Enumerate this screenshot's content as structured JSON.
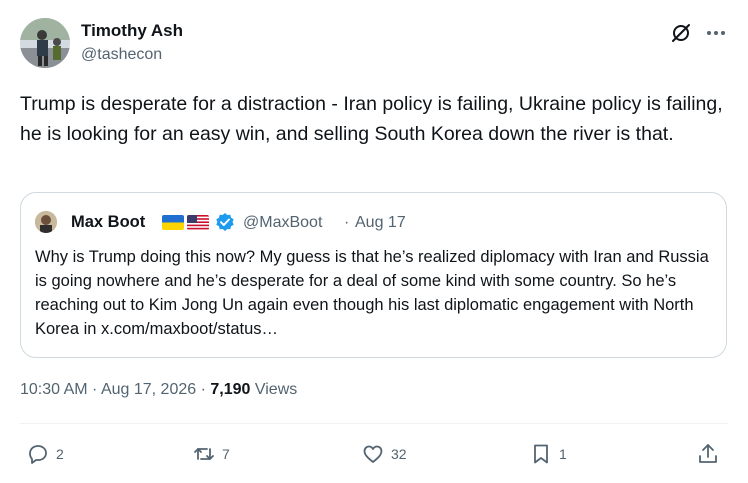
{
  "author": {
    "name": "Timothy Ash",
    "handle": "@tashecon"
  },
  "tweet": {
    "text": "Trump is desperate for a distraction - Iran policy is failing, Ukraine policy is failing, he is looking for an easy win, and selling South Korea down the river is that."
  },
  "quote": {
    "name": "Max Boot",
    "handle": "@MaxBoot",
    "separator": "·",
    "date": "Aug 17",
    "text": "Why is Trump doing this now? My guess is that he’s realized diplomacy with Iran and Russia is going nowhere and he’s desperate for a deal of some kind with some country. So he’s reaching out to Kim Jong Un again even though his last diplomatic engagement with North Korea in x.com/maxboot/status…"
  },
  "meta": {
    "time": "10:30 AM",
    "sep1": " · ",
    "date": "Aug 17, 2026",
    "sep2": " · ",
    "views_count": "7,190",
    "views_label": " Views"
  },
  "actions": {
    "replies": "2",
    "reposts": "7",
    "likes": "32",
    "bookmarks": "1"
  },
  "colors": {
    "text": "#0f1419",
    "secondary": "#536471",
    "border": "#cfd9de",
    "verified": "#1d9bf0"
  },
  "icons": [
    "grok-icon",
    "more-icon",
    "verified-icon",
    "reply-icon",
    "retweet-icon",
    "like-icon",
    "bookmark-icon",
    "share-icon"
  ]
}
